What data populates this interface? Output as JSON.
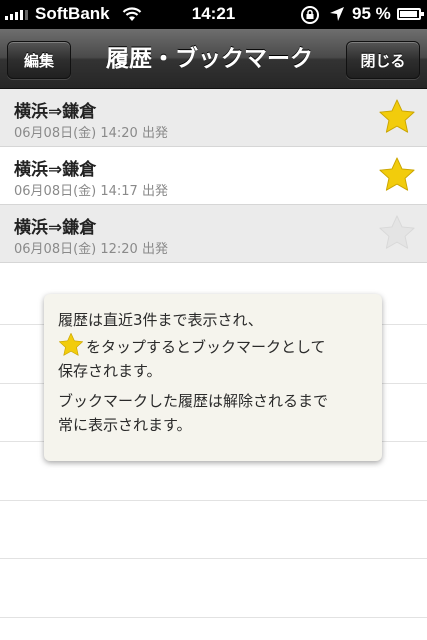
{
  "status_bar": {
    "carrier": "SoftBank",
    "time": "14:21",
    "battery": "95 %",
    "battery_level": 0.95,
    "icons": [
      "signal-icon",
      "wifi-icon",
      "rotation-lock-icon",
      "location-icon",
      "battery-icon"
    ]
  },
  "nav": {
    "edit_label": "編集",
    "title": "履歴・ブックマーク",
    "close_label": "閉じる"
  },
  "history": [
    {
      "route": "横浜⇒鎌倉",
      "datetime": "06月08日(金) 14:20 出発",
      "bookmarked": true
    },
    {
      "route": "横浜⇒鎌倉",
      "datetime": "06月08日(金) 14:17 出発",
      "bookmarked": true
    },
    {
      "route": "横浜⇒鎌倉",
      "datetime": "06月08日(金) 12:20 出発",
      "bookmarked": false
    }
  ],
  "tooltip": {
    "line1": "履歴は直近3件まで表示され、",
    "line2": "をタップするとブックマークとして",
    "line3": "保存されます。",
    "line4": "ブックマークした履歴は解除されるまで",
    "line5": "常に表示されます。"
  },
  "colors": {
    "star_on": "#f2cc0c",
    "star_off": "#e4e4e4",
    "nav_bg": "#3a3a3a",
    "row_alt_bg": "#ebebeb"
  }
}
